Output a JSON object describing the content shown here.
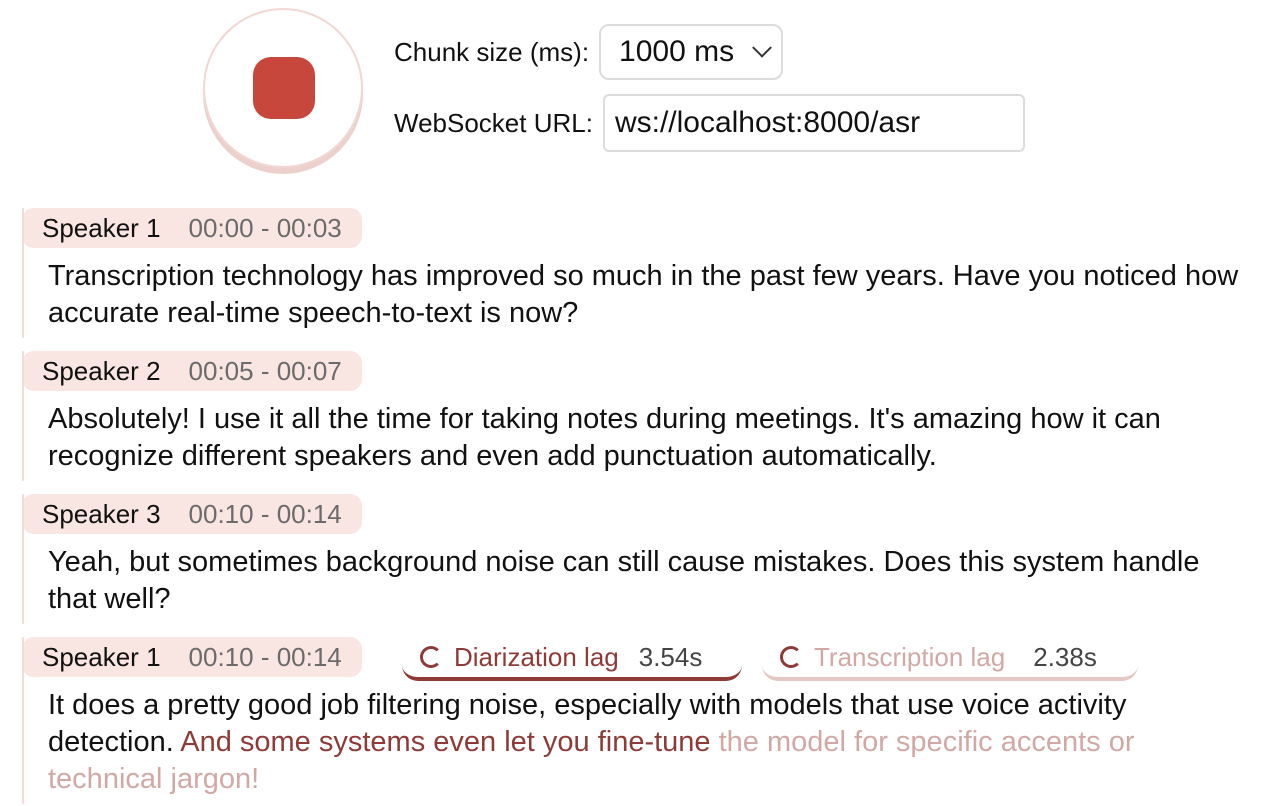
{
  "recorder": {
    "state": "recording",
    "button_icon": "stop-square-icon"
  },
  "settings": {
    "chunk_label": "Chunk size (ms):",
    "chunk_value": "1000 ms",
    "url_label": "WebSocket URL:",
    "url_value": "ws://localhost:8000/asr"
  },
  "transcript": [
    {
      "speaker": "Speaker 1",
      "time": "00:00 - 00:03",
      "text": "Transcription technology has improved so much in the past few years. Have you noticed how accurate real-time speech-to-text is now?"
    },
    {
      "speaker": "Speaker 2",
      "time": "00:05 - 00:07",
      "text": "Absolutely! I use it all the time for taking notes during meetings. It's amazing how it can recognize different speakers and even add punctuation automatically."
    },
    {
      "speaker": "Speaker 3",
      "time": "00:10 - 00:14",
      "text": "Yeah, but sometimes background noise can still cause mistakes. Does this system handle that well?"
    },
    {
      "speaker": "Speaker 1",
      "time": "00:10 - 00:14",
      "text": "It does a pretty good job filtering noise, especially with models that use voice activity detection.",
      "buffer_diarization": " And some systems even let you fine-tune",
      "buffer_transcription": " the model for specific accents or technical jargon!",
      "diarization_lag_label": "Diarization lag",
      "diarization_lag_value": "3.54s",
      "transcription_lag_label": "Transcription lag",
      "transcription_lag_value": "2.38s"
    }
  ],
  "colors": {
    "accent": "#c8473d",
    "pill_bg": "#f9e5e1",
    "diarization": "#8e3b37",
    "transcription": "#d2a8a5"
  }
}
